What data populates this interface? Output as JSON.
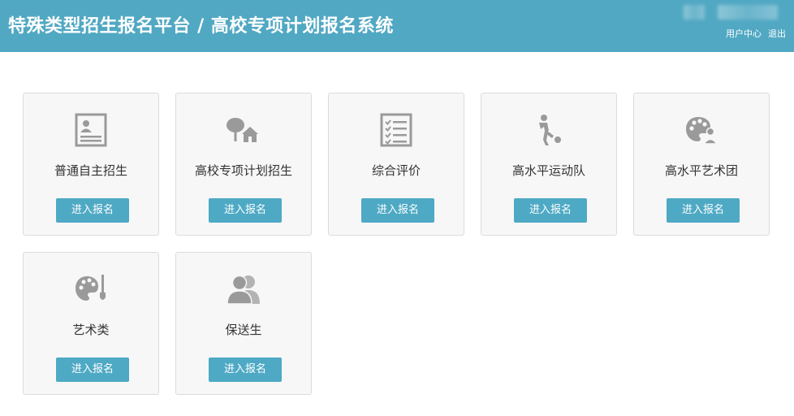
{
  "header": {
    "title": "特殊类型招生报名平台 / 高校专项计划报名系统",
    "links": [
      "用户中心",
      "退出"
    ],
    "background_color": "#51a8c3"
  },
  "cards": [
    {
      "label": "普通自主招生",
      "button": "进入报名",
      "icon": "id-card-icon"
    },
    {
      "label": "高校专项计划招生",
      "button": "进入报名",
      "icon": "tree-house-icon"
    },
    {
      "label": "综合评价",
      "button": "进入报名",
      "icon": "checklist-icon"
    },
    {
      "label": "高水平运动队",
      "button": "进入报名",
      "icon": "soccer-player-icon"
    },
    {
      "label": "高水平艺术团",
      "button": "进入报名",
      "icon": "palette-person-icon"
    },
    {
      "label": "艺术类",
      "button": "进入报名",
      "icon": "palette-brush-icon"
    },
    {
      "label": "保送生",
      "button": "进入报名",
      "icon": "users-icon"
    }
  ],
  "colors": {
    "button": "#4ea9c4",
    "card_background": "#f7f7f8",
    "icon": "#9a9a9a"
  }
}
